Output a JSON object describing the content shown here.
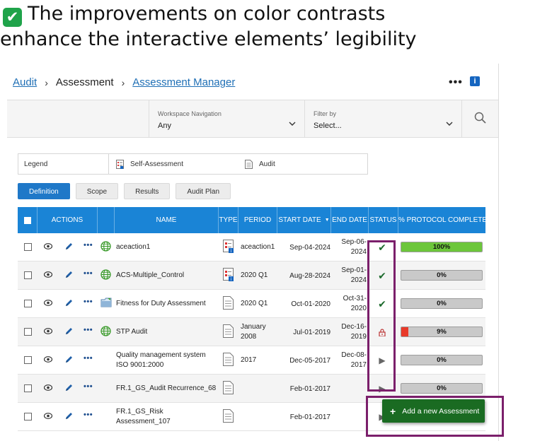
{
  "headline": {
    "line1": "The improvements on color contrasts",
    "line2": "enhance the interactive elements’ legibility"
  },
  "breadcrumb": {
    "audit": "Audit",
    "assessment": "Assessment",
    "manager": "Assessment Manager",
    "separator": "›"
  },
  "toolbar": {
    "more_label": "•••",
    "info_label": "i"
  },
  "filters": {
    "workspace_label": "Workspace Navigation",
    "workspace_value": "Any",
    "filter_label": "Filter by",
    "filter_value": "Select...",
    "chevron": "⌄"
  },
  "legend": {
    "title": "Legend",
    "self_assessment": "Self-Assessment",
    "audit": "Audit"
  },
  "tabs": [
    "Definition",
    "Scope",
    "Results",
    "Audit Plan"
  ],
  "columns": {
    "actions": "ACTIONS",
    "name": "NAME",
    "type": "TYPE",
    "period": "PERIOD",
    "start_date": "START DATE",
    "sort_caret": "▼",
    "end_date": "END DATE",
    "status": "STATUS",
    "protocol": "% PROTOCOL COMPLETE"
  },
  "rows": [
    {
      "name": "aceaction1",
      "icon": "globe",
      "type": "self-assessment",
      "period": "aceaction1",
      "start": "Sep-04-2024",
      "end": "Sep-06-2024",
      "status": "✔",
      "progress_label": "100%",
      "progress": 1.0,
      "fill_color": "#6cc63b"
    },
    {
      "name": "ACS-Multiple_Control",
      "icon": "globe",
      "type": "self-assessment",
      "period": "2020 Q1",
      "start": "Aug-28-2024",
      "end": "Sep-01-2024",
      "status": "✔",
      "progress_label": "0%",
      "progress": 0.0,
      "fill_color": "#6cc63b"
    },
    {
      "name": "Fitness for Duty Assessment",
      "icon": "folder",
      "type": "audit",
      "period": "2020 Q1",
      "start": "Oct-01-2020",
      "end": "Oct-31-2020",
      "status": "✔",
      "progress_label": "0%",
      "progress": 0.0,
      "fill_color": "#6cc63b"
    },
    {
      "name": "STP Audit",
      "icon": "globe",
      "type": "audit",
      "period": "January 2008",
      "start": "Jul-01-2019",
      "end": "Dec-16-2019",
      "status": "🔓",
      "progress_label": "9%",
      "progress": 0.09,
      "fill_color": "#e83a2a"
    },
    {
      "name": "Quality management system ISO 9001:2000",
      "icon": "",
      "type": "audit",
      "period": "2017",
      "start": "Dec-05-2017",
      "end": "Dec-08-2017",
      "status": "▶",
      "progress_label": "0%",
      "progress": 0.0,
      "fill_color": "#6cc63b"
    },
    {
      "name": "FR.1_GS_Audit Recurrence_68",
      "icon": "",
      "type": "audit",
      "period": "",
      "start": "Feb-01-2017",
      "end": "",
      "status": "▶",
      "progress_label": "0%",
      "progress": 0.0,
      "fill_color": "#6cc63b"
    },
    {
      "name": "FR.1_GS_Risk Assessment_107",
      "icon": "",
      "type": "audit",
      "period": "",
      "start": "Feb-01-2017",
      "end": "",
      "status": "▶",
      "progress_label": "",
      "progress": 0.0,
      "fill_color": "#6cc63b"
    }
  ],
  "add_button": {
    "plus": "+",
    "label": "Add a new Assessment",
    "color": "#1a6b22"
  },
  "colors": {
    "accent": "#1a84d6",
    "highlight": "#7b1f6b",
    "link": "#1f6fb5"
  }
}
